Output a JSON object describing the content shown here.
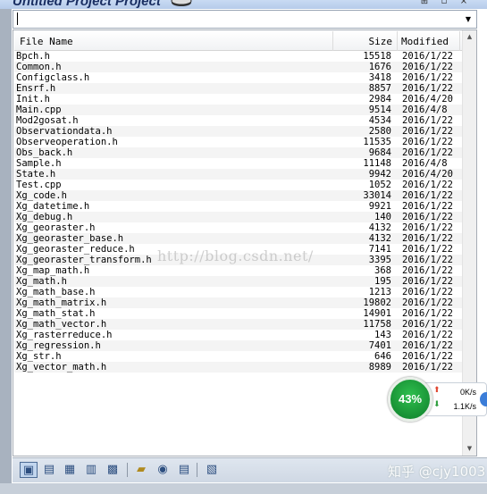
{
  "window": {
    "title": "Untitled Project Project"
  },
  "combo": {
    "value": ""
  },
  "table": {
    "columns": {
      "name": "File Name",
      "size": "Size",
      "modified": "Modified"
    },
    "rows": [
      {
        "name": "Bpch.h",
        "size": "15518",
        "modified": "2016/1/22"
      },
      {
        "name": "Common.h",
        "size": "1676",
        "modified": "2016/1/22"
      },
      {
        "name": "Configclass.h",
        "size": "3418",
        "modified": "2016/1/22"
      },
      {
        "name": "Ensrf.h",
        "size": "8857",
        "modified": "2016/1/22"
      },
      {
        "name": "Init.h",
        "size": "2984",
        "modified": "2016/4/20"
      },
      {
        "name": "Main.cpp",
        "size": "9514",
        "modified": "2016/4/8"
      },
      {
        "name": "Mod2gosat.h",
        "size": "4534",
        "modified": "2016/1/22"
      },
      {
        "name": "Observationdata.h",
        "size": "2580",
        "modified": "2016/1/22"
      },
      {
        "name": "Observeoperation.h",
        "size": "11535",
        "modified": "2016/1/22"
      },
      {
        "name": "Obs_back.h",
        "size": "9684",
        "modified": "2016/1/22"
      },
      {
        "name": "Sample.h",
        "size": "11148",
        "modified": "2016/4/8"
      },
      {
        "name": "State.h",
        "size": "9942",
        "modified": "2016/4/20"
      },
      {
        "name": "Test.cpp",
        "size": "1052",
        "modified": "2016/1/22"
      },
      {
        "name": "Xg_code.h",
        "size": "33014",
        "modified": "2016/1/22"
      },
      {
        "name": "Xg_datetime.h",
        "size": "9921",
        "modified": "2016/1/22"
      },
      {
        "name": "Xg_debug.h",
        "size": "140",
        "modified": "2016/1/22"
      },
      {
        "name": "Xg_georaster.h",
        "size": "4132",
        "modified": "2016/1/22"
      },
      {
        "name": "Xg_georaster_base.h",
        "size": "4132",
        "modified": "2016/1/22"
      },
      {
        "name": "Xg_georaster_reduce.h",
        "size": "7141",
        "modified": "2016/1/22"
      },
      {
        "name": "Xg_georaster_transform.h",
        "size": "3395",
        "modified": "2016/1/22"
      },
      {
        "name": "Xg_map_math.h",
        "size": "368",
        "modified": "2016/1/22"
      },
      {
        "name": "Xg_math.h",
        "size": "195",
        "modified": "2016/1/22"
      },
      {
        "name": "Xg_math_base.h",
        "size": "1213",
        "modified": "2016/1/22"
      },
      {
        "name": "Xg_math_matrix.h",
        "size": "19802",
        "modified": "2016/1/22"
      },
      {
        "name": "Xg_math_stat.h",
        "size": "14901",
        "modified": "2016/1/22"
      },
      {
        "name": "Xg_math_vector.h",
        "size": "11758",
        "modified": "2016/1/22"
      },
      {
        "name": "Xg_rasterreduce.h",
        "size": "143",
        "modified": "2016/1/22"
      },
      {
        "name": "Xg_regression.h",
        "size": "7401",
        "modified": "2016/1/22"
      },
      {
        "name": "Xg_str.h",
        "size": "646",
        "modified": "2016/1/22"
      },
      {
        "name": "Xg_vector_math.h",
        "size": "8989",
        "modified": "2016/1/22"
      }
    ]
  },
  "watermark": "http://blog.csdn.net/",
  "net_widget": {
    "percent_label": "43%",
    "upload": "0K/s",
    "download": "1.1K/s",
    "accent_color": "#1a9a3a"
  },
  "toolbar": {
    "icons": [
      "file-view-icon",
      "list-icon",
      "symbols-icon",
      "book-icon",
      "classes-icon",
      "open-folder-icon",
      "add-file-icon",
      "document-icon",
      "properties-icon"
    ]
  },
  "credit": "知乎 @cjy1003"
}
